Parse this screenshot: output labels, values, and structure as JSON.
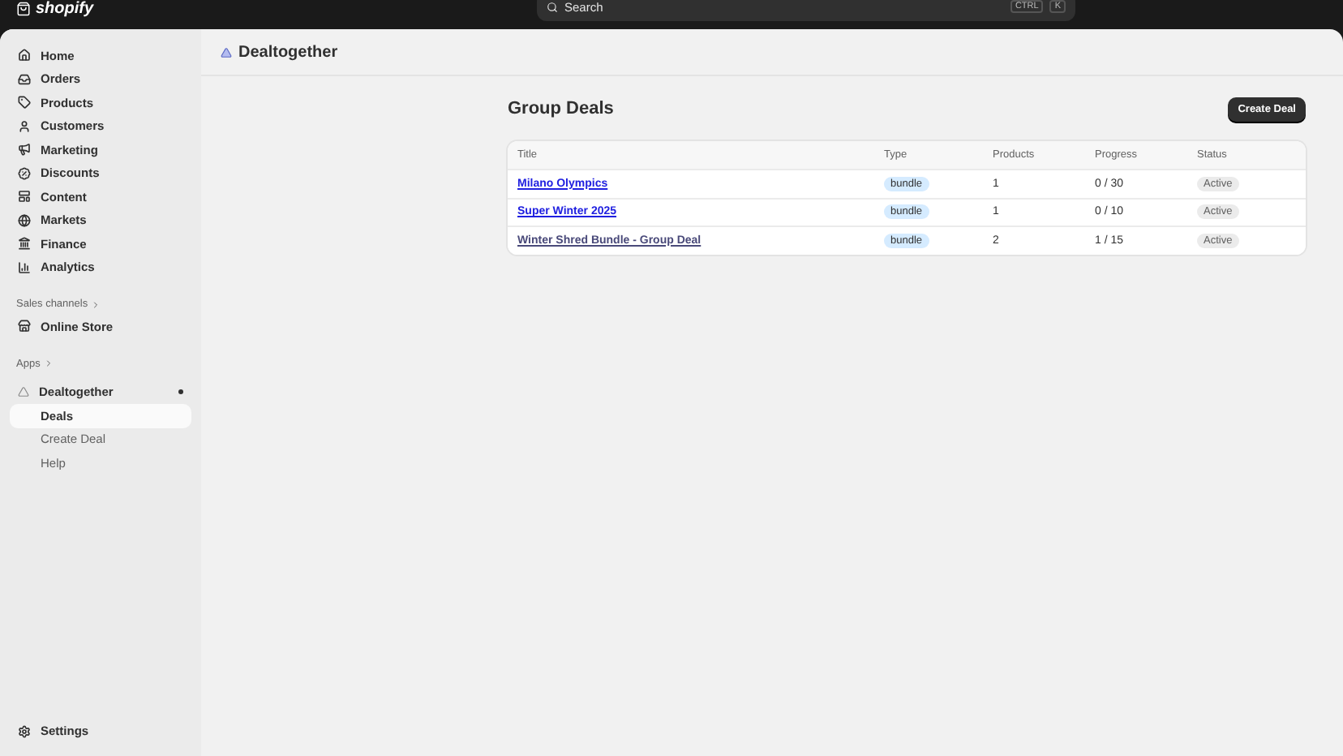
{
  "topbar": {
    "logo": "shopify",
    "search": {
      "placeholder": "Search"
    },
    "shortcut": [
      "CTRL",
      "K"
    ]
  },
  "sidebar": {
    "items": [
      {
        "label": "Home",
        "selected": false
      },
      {
        "label": "Orders",
        "selected": false
      },
      {
        "label": "Products",
        "selected": false
      },
      {
        "label": "Customers",
        "selected": false
      },
      {
        "label": "Marketing",
        "selected": false
      },
      {
        "label": "Discounts",
        "selected": false
      },
      {
        "label": "Content",
        "selected": false
      },
      {
        "label": "Markets",
        "selected": false
      },
      {
        "label": "Finance",
        "selected": false
      },
      {
        "label": "Analytics",
        "selected": false
      }
    ],
    "sales_channels": {
      "heading": "Sales channels",
      "items": [
        {
          "label": "Online Store"
        }
      ]
    },
    "apps": {
      "heading": "Apps",
      "app": {
        "label": "Dealtogether",
        "children": [
          {
            "label": "Deals",
            "selected": true
          },
          {
            "label": "Create Deal",
            "selected": false
          },
          {
            "label": "Help",
            "selected": false
          }
        ]
      }
    },
    "settings": "Settings"
  },
  "app_header": {
    "title": "Dealtogether"
  },
  "page": {
    "title": "Group Deals",
    "primary_action": "Create Deal",
    "table": {
      "columns": [
        "Title",
        "Type",
        "Products",
        "Progress",
        "Status"
      ],
      "rows": [
        {
          "title": "Milano Olympics",
          "visited": false,
          "type": "bundle",
          "products": "1",
          "progress": "0 / 30",
          "status": "Active"
        },
        {
          "title": "Super Winter 2025",
          "visited": false,
          "type": "bundle",
          "products": "1",
          "progress": "0 / 10",
          "status": "Active"
        },
        {
          "title": "Winter Shred Bundle - Group Deal",
          "visited": true,
          "type": "bundle",
          "products": "2",
          "progress": "1 / 15",
          "status": "Active"
        }
      ]
    }
  }
}
